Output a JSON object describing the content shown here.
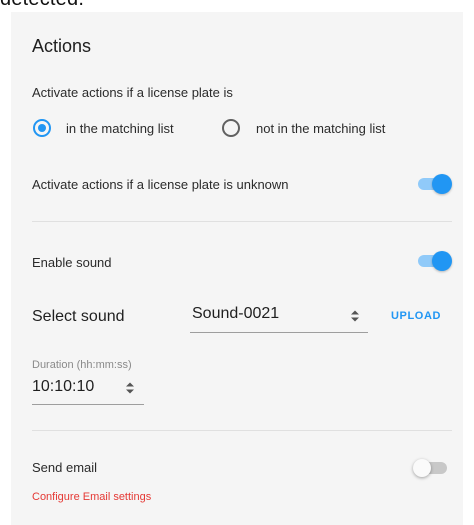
{
  "clipped_top_text": "detected.",
  "actions": {
    "title": "Actions",
    "activate_if_plate_is": "Activate actions if a license plate is",
    "radio_options": [
      {
        "label": "in the matching list",
        "checked": true
      },
      {
        "label": "not in the matching list",
        "checked": false
      }
    ],
    "unknown_plate_label": "Activate actions if a license plate is unknown",
    "unknown_plate_enabled": true
  },
  "sound": {
    "enable_label": "Enable sound",
    "enabled": true,
    "select_label": "Select sound",
    "selected_sound": "Sound-0021",
    "upload_label": "UPLOAD",
    "duration_caption": "Duration (hh:mm:ss)",
    "duration_value": "10:10:10"
  },
  "email": {
    "send_label": "Send email",
    "enabled": false,
    "configure_link": "Configure Email settings"
  },
  "colors": {
    "accent": "#2196f3",
    "toggle_track_on": "#90caf9",
    "link_red": "#e53935",
    "panel_bg": "#f5f5f5"
  }
}
